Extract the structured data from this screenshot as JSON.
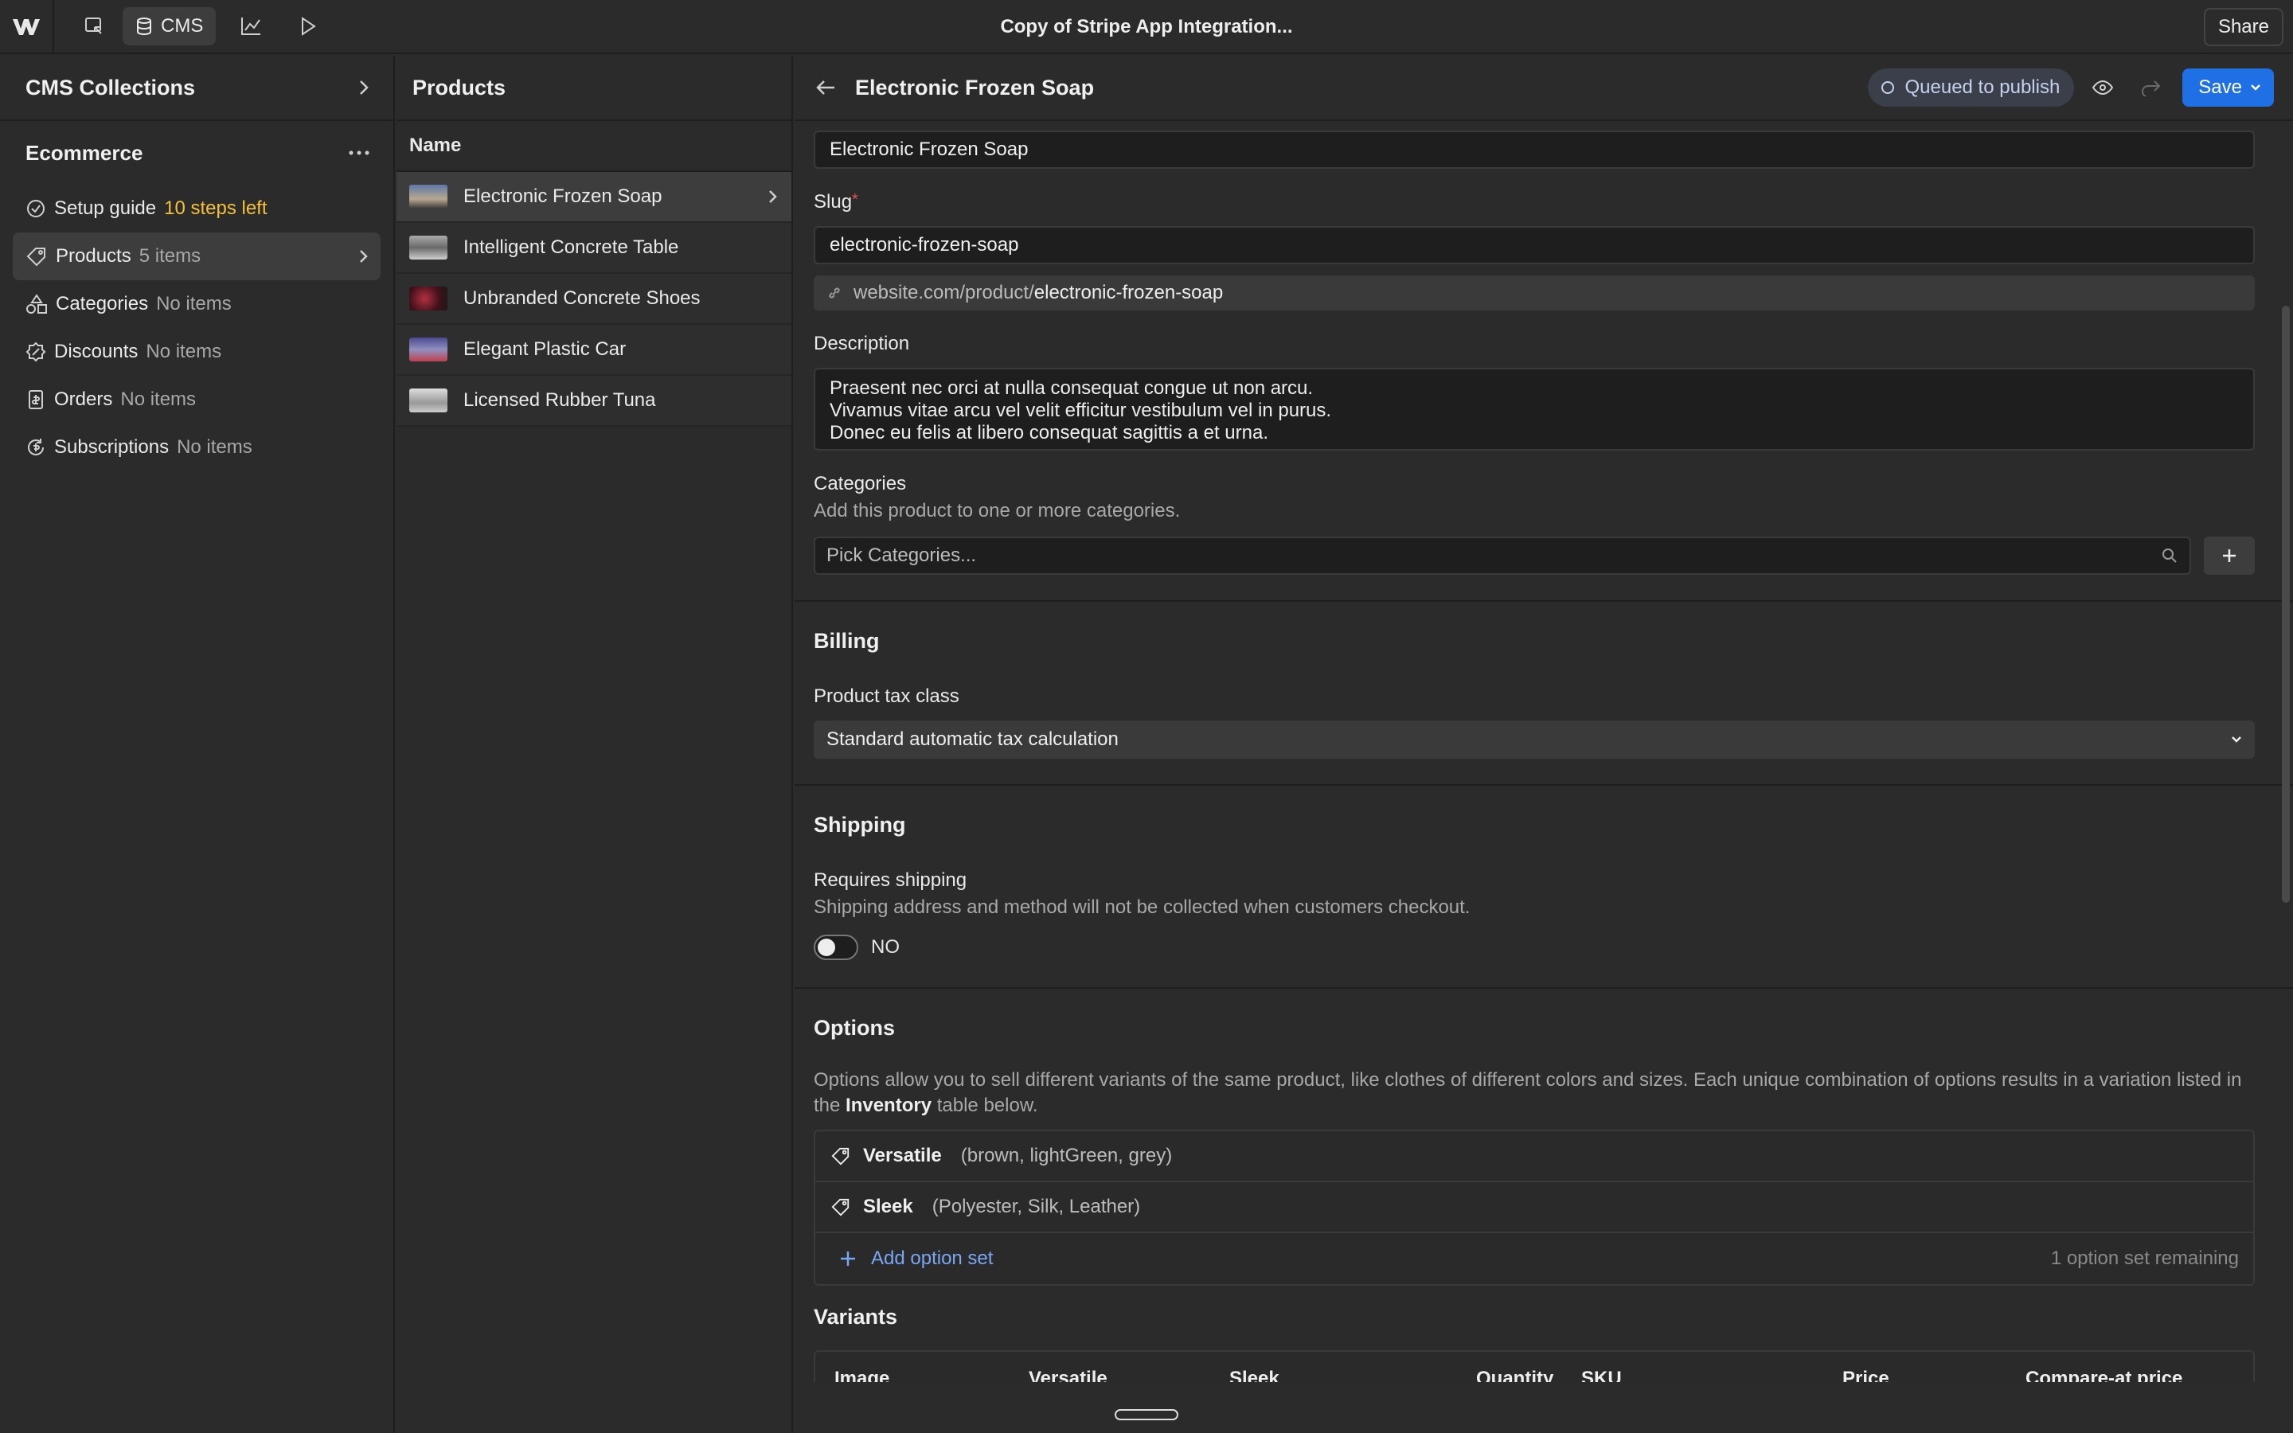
{
  "topbar": {
    "cms_label": "CMS",
    "title": "Copy of Stripe App Integration...",
    "share_label": "Share"
  },
  "left": {
    "header": "CMS Collections",
    "section": "Ecommerce",
    "items": [
      {
        "label": "Setup guide",
        "sub": "10 steps left",
        "icon": "check-circle-icon"
      },
      {
        "label": "Products",
        "sub": "5 items",
        "icon": "tag-icon"
      },
      {
        "label": "Categories",
        "sub": "No items",
        "icon": "shapes-icon"
      },
      {
        "label": "Discounts",
        "sub": "No items",
        "icon": "discount-icon"
      },
      {
        "label": "Orders",
        "sub": "No items",
        "icon": "receipt-icon"
      },
      {
        "label": "Subscriptions",
        "sub": "No items",
        "icon": "subscription-icon"
      }
    ]
  },
  "products": {
    "header": "Products",
    "column": "Name",
    "rows": [
      {
        "name": "Electronic Frozen Soap",
        "thumb": "#7a8fb0"
      },
      {
        "name": "Intelligent Concrete Table",
        "thumb": "#8c8c8c"
      },
      {
        "name": "Unbranded Concrete Shoes",
        "thumb": "#7a2a33"
      },
      {
        "name": "Elegant Plastic Car",
        "thumb": "#5a5a8a"
      },
      {
        "name": "Licensed Rubber Tuna",
        "thumb": "#a0a0a0"
      }
    ]
  },
  "detail": {
    "title": "Electronic Frozen Soap",
    "status": "Queued to publish",
    "save_label": "Save",
    "name_value": "Electronic Frozen Soap",
    "slug_label": "Slug",
    "slug_required": "*",
    "slug_value": "electronic-frozen-soap",
    "slug_prefix": "website.com/product/",
    "slug_path": "electronic-frozen-soap",
    "description_label": "Description",
    "description_lines": [
      "Praesent nec orci at nulla consequat congue ut non arcu.",
      "Vivamus vitae arcu vel velit efficitur vestibulum vel in purus.",
      "Donec eu felis at libero consequat sagittis a et urna."
    ],
    "categories_label": "Categories",
    "categories_help": "Add this product to one or more categories.",
    "categories_placeholder": "Pick Categories...",
    "billing_title": "Billing",
    "tax_label": "Product tax class",
    "tax_value": "Standard automatic tax calculation",
    "shipping_title": "Shipping",
    "requires_shipping_label": "Requires shipping",
    "shipping_help": "Shipping address and method will not be collected when customers checkout.",
    "shipping_toggle": "NO",
    "options_title": "Options",
    "options_help_1": "Options allow you to sell different variants of the same product, like clothes of different colors and sizes. Each unique combination of options results in a variation listed in the ",
    "options_help_bold": "Inventory",
    "options_help_2": " table below.",
    "option_sets": [
      {
        "name": "Versatile",
        "values": "(brown, lightGreen, grey)"
      },
      {
        "name": "Sleek",
        "values": "(Polyester, Silk, Leather)"
      }
    ],
    "add_option_label": "Add option set",
    "option_remaining": "1 option set remaining",
    "variants_title": "Variants",
    "variants_columns": [
      "Image",
      "Versatile",
      "Sleek",
      "Quantity",
      "SKU",
      "Price",
      "Compare-at price"
    ]
  }
}
